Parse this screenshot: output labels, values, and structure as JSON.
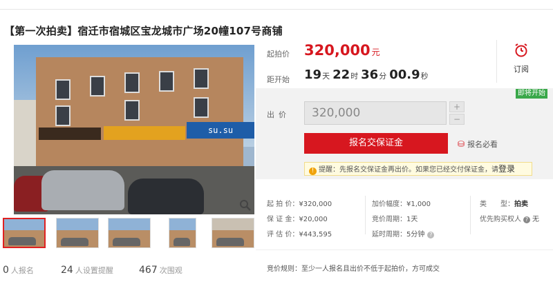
{
  "title": "【第一次拍卖】宿迁市宿城区宝龙城市广场20幢107号商铺",
  "photo": {
    "sign_text": "su.su"
  },
  "stats": [
    {
      "num": "0",
      "label": "人报名"
    },
    {
      "num": "24",
      "label": "人设置提醒"
    },
    {
      "num": "467",
      "label": "次围观"
    }
  ],
  "price": {
    "label": "起拍价",
    "value": "320,000",
    "unit": "元"
  },
  "countdown": {
    "label": "距开始",
    "days": "19",
    "days_unit": "天",
    "hours": "22",
    "hours_unit": "时",
    "minutes": "36",
    "minutes_unit": "分",
    "seconds": "00.9",
    "seconds_unit": "秒"
  },
  "remind": {
    "label": "订阅"
  },
  "badge": "即将开始",
  "bid": {
    "label": "出价",
    "value": "320,000",
    "plus": "+",
    "minus": "−"
  },
  "deposit_button": "报名交保证金",
  "must_read": "报名必看",
  "tip": {
    "prefix": "提醒：",
    "text": "先报名交保证金再出价。如果您已经交付保证金，请",
    "login": "登录"
  },
  "info": {
    "start_price": {
      "k": "起 拍 价：",
      "v": "¥320,000"
    },
    "deposit": {
      "k": "保 证 金：",
      "v": "¥20,000"
    },
    "appraisal": {
      "k": "评 估 价：",
      "v": "¥443,595"
    },
    "increment": {
      "k": "加价幅度：",
      "v": "¥1,000"
    },
    "cycle": {
      "k": "竞价周期：",
      "v": "1天"
    },
    "delay": {
      "k": "延时周期：",
      "v": "5分钟"
    },
    "type": {
      "k": "类　　型：",
      "v": "拍卖"
    },
    "priority": {
      "k": "优先购买权人",
      "v": "无"
    }
  },
  "rule": {
    "k": "竞价规则：",
    "v": "至少一人报名且出价不低于起拍价，方可成交"
  },
  "colors": {
    "accent": "#d7171f",
    "badge_green": "#3aa84a",
    "tip_bg": "#fffbe0"
  }
}
